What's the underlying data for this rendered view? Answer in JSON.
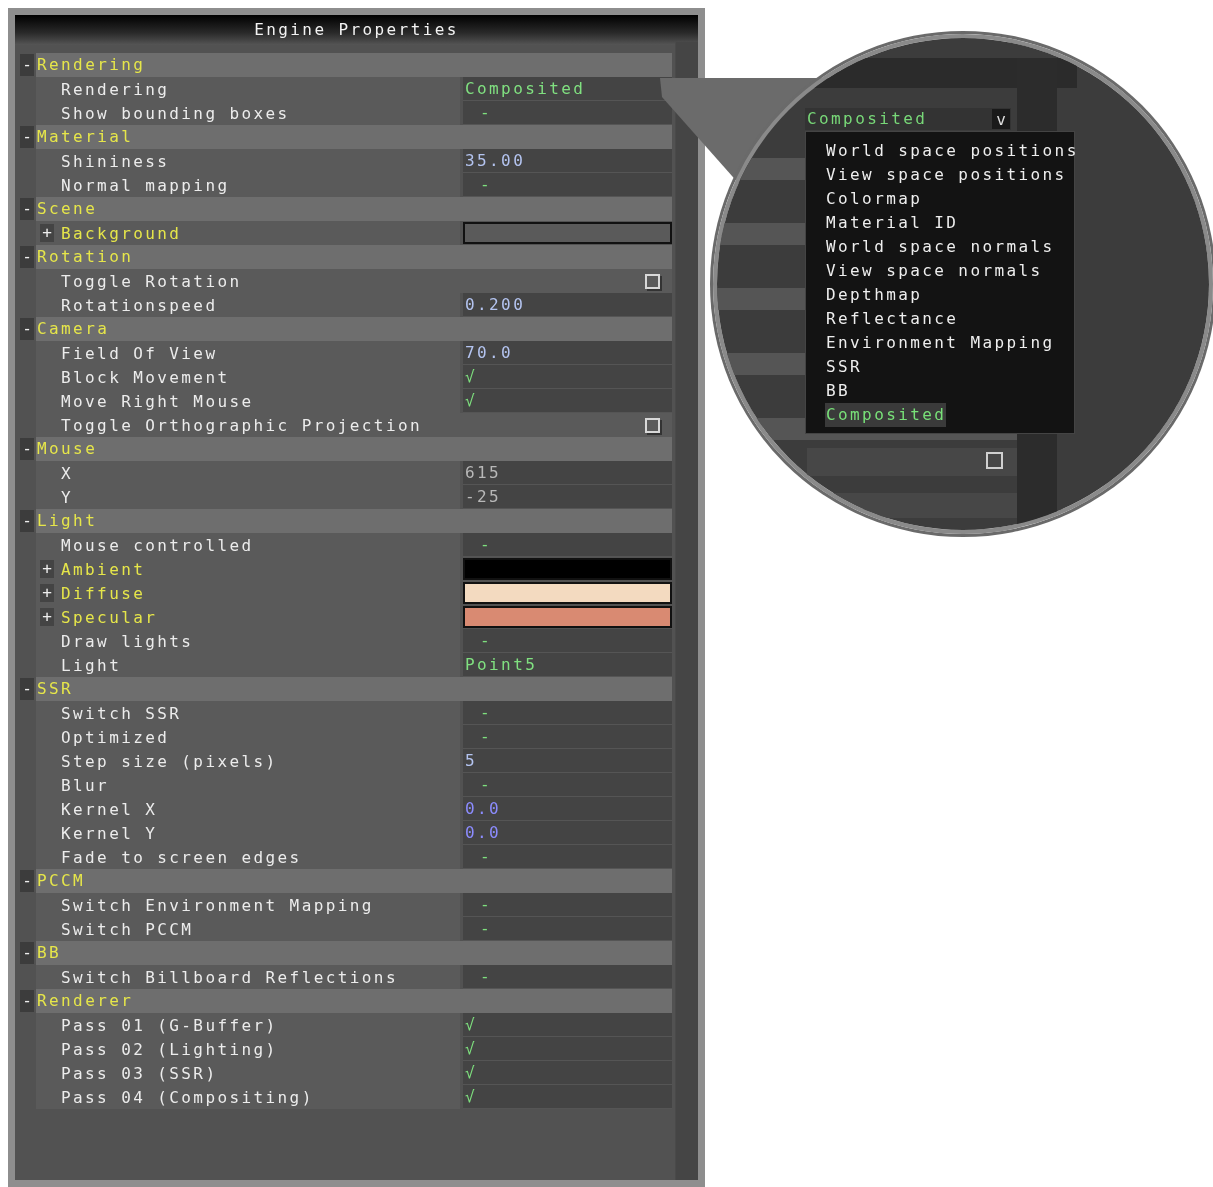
{
  "window": {
    "title": "Engine Properties"
  },
  "groups": [
    {
      "toggle": "-",
      "title": "Rendering",
      "rows": [
        {
          "kind": "text",
          "label": "Rendering",
          "value": "Composited"
        },
        {
          "kind": "flag",
          "label": "Show bounding boxes",
          "value": "-",
          "checked": false
        }
      ]
    },
    {
      "toggle": "-",
      "title": "Material",
      "rows": [
        {
          "kind": "number",
          "label": "Shininess",
          "value": "35.00"
        },
        {
          "kind": "flag",
          "label": "Normal mapping",
          "value": "-",
          "checked": false
        }
      ]
    },
    {
      "toggle": "-",
      "title": "Scene",
      "rows": [
        {
          "kind": "color",
          "toggle": "+",
          "label": "Background",
          "color": "#5a5a5a"
        }
      ]
    },
    {
      "toggle": "-",
      "title": "Rotation",
      "rows": [
        {
          "kind": "checkbox",
          "label": "Toggle Rotation",
          "checked": false
        },
        {
          "kind": "number",
          "label": "Rotationspeed",
          "value": "0.200"
        }
      ]
    },
    {
      "toggle": "-",
      "title": "Camera",
      "rows": [
        {
          "kind": "number",
          "label": "Field Of View",
          "value": "70.0"
        },
        {
          "kind": "flag",
          "label": "Block Movement",
          "value": "√",
          "checked": true
        },
        {
          "kind": "flag",
          "label": "Move Right Mouse",
          "value": "√",
          "checked": true
        },
        {
          "kind": "checkbox",
          "label": "Toggle Orthographic Projection",
          "checked": false
        }
      ]
    },
    {
      "toggle": "-",
      "title": "Mouse",
      "rows": [
        {
          "kind": "readonly",
          "label": "X",
          "value": "615"
        },
        {
          "kind": "readonly",
          "label": "Y",
          "value": "-25"
        }
      ]
    },
    {
      "toggle": "-",
      "title": "Light",
      "rows": [
        {
          "kind": "flag",
          "label": "Mouse controlled",
          "value": "-",
          "checked": false
        },
        {
          "kind": "color",
          "toggle": "+",
          "label": "Ambient",
          "color": "#000000"
        },
        {
          "kind": "color",
          "toggle": "+",
          "label": "Diffuse",
          "color": "#f3dac0"
        },
        {
          "kind": "color",
          "toggle": "+",
          "label": "Specular",
          "color": "#d98a72"
        },
        {
          "kind": "flag",
          "label": "Draw lights",
          "value": "-",
          "checked": false
        },
        {
          "kind": "text",
          "label": "Light",
          "value": "Point5"
        }
      ]
    },
    {
      "toggle": "-",
      "title": "SSR",
      "rows": [
        {
          "kind": "flag",
          "label": "Switch SSR",
          "value": "-",
          "checked": false
        },
        {
          "kind": "flag",
          "label": "Optimized",
          "value": "-",
          "checked": false
        },
        {
          "kind": "number",
          "label": "Step size (pixels)",
          "value": "5"
        },
        {
          "kind": "flag",
          "label": "Blur",
          "value": "-",
          "checked": false
        },
        {
          "kind": "vector",
          "label": "Kernel X",
          "value": "0.0"
        },
        {
          "kind": "vector",
          "label": "Kernel Y",
          "value": "0.0"
        },
        {
          "kind": "flag",
          "label": "Fade to screen edges",
          "value": "-",
          "checked": false
        }
      ]
    },
    {
      "toggle": "-",
      "title": "PCCM",
      "rows": [
        {
          "kind": "flag",
          "label": "Switch Environment Mapping",
          "value": "-",
          "checked": false
        },
        {
          "kind": "flag",
          "label": "Switch PCCM",
          "value": "-",
          "checked": false
        }
      ]
    },
    {
      "toggle": "-",
      "title": "BB",
      "rows": [
        {
          "kind": "flag",
          "label": "Switch Billboard Reflections",
          "value": "-",
          "checked": false
        }
      ]
    },
    {
      "toggle": "-",
      "title": "Renderer",
      "rows": [
        {
          "kind": "flag",
          "label": "Pass 01 (G-Buffer)",
          "value": "√",
          "checked": true
        },
        {
          "kind": "flag",
          "label": "Pass 02 (Lighting)",
          "value": "√",
          "checked": true
        },
        {
          "kind": "flag",
          "label": "Pass 03 (SSR)",
          "value": "√",
          "checked": true
        },
        {
          "kind": "flag",
          "label": "Pass 04 (Compositing)",
          "value": "√",
          "checked": true
        }
      ]
    }
  ],
  "magnifier": {
    "dropdown": {
      "value": "Composited",
      "caret": "v",
      "options": [
        {
          "label": "World space positions",
          "selected": false
        },
        {
          "label": "View space positions",
          "selected": false
        },
        {
          "label": "Colormap",
          "selected": false
        },
        {
          "label": "Material ID",
          "selected": false
        },
        {
          "label": "World space normals",
          "selected": false
        },
        {
          "label": "View space normals",
          "selected": false
        },
        {
          "label": "Depthmap",
          "selected": false
        },
        {
          "label": "Reflectance",
          "selected": false
        },
        {
          "label": "Environment Mapping",
          "selected": false
        },
        {
          "label": "SSR",
          "selected": false
        },
        {
          "label": "BB",
          "selected": false
        },
        {
          "label": "Composited",
          "selected": true
        }
      ]
    }
  }
}
